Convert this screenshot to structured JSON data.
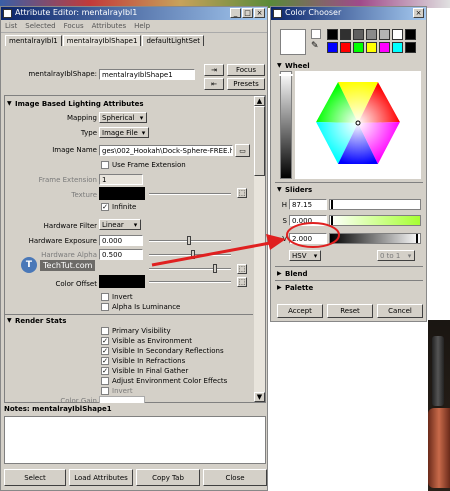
{
  "attr_editor": {
    "title": "Attribute Editor: mentalrayIbl1",
    "menu": [
      "List",
      "Selected",
      "Focus",
      "Attributes",
      "Help"
    ],
    "tabs": [
      "mentalrayIbl1",
      "mentalrayIblShape1",
      "defaultLightSet"
    ],
    "shape_label": "mentalrayIblShape:",
    "shape_value": "mentalrayIblShape1",
    "focus_btn": "Focus",
    "presets_btn": "Presets",
    "ibl_section": "Image Based Lighting Attributes",
    "mapping_label": "Mapping",
    "mapping_value": "Spherical",
    "type_label": "Type",
    "type_value": "Image File",
    "image_name_label": "Image Name",
    "image_name_value": "ges\\002_Hookah\\Dock-Sphere-FREE.hdr",
    "use_frame_ext": "Use Frame Extension",
    "frame_ext_label": "Frame Extension",
    "frame_ext_value": "1",
    "texture_label": "Texture",
    "infinite": "Infinite",
    "hw_filter_label": "Hardware Filter",
    "hw_filter_value": "Linear",
    "hw_exposure_label": "Hardware Exposure",
    "hw_exposure_value": "0.000",
    "hw_alpha_label": "Hardware Alpha",
    "hw_alpha_value": "0.500",
    "watermark": "TechTut.com",
    "color_offset_label": "Color Offset",
    "invert": "Invert",
    "alpha_is_lum": "Alpha Is Luminance",
    "render_stats_section": "Render Stats",
    "render_stats": [
      {
        "label": "Primary Visibility",
        "checked": false
      },
      {
        "label": "Visible as Environment",
        "checked": true
      },
      {
        "label": "Visible In Secondary Reflections",
        "checked": true
      },
      {
        "label": "Visible In Refractions",
        "checked": true
      },
      {
        "label": "Visible In Final Gather",
        "checked": true
      },
      {
        "label": "Adjust Environment Color Effects",
        "checked": false
      }
    ],
    "invert2": "Invert",
    "color_gain_label": "Color Gain",
    "notes_label": "Notes:  mentalrayIblShape1",
    "bottom_buttons": [
      "Select",
      "Load Attributes",
      "Copy Tab",
      "Close"
    ]
  },
  "color_chooser": {
    "title": "Color Chooser",
    "wheel_section": "Wheel",
    "sliders_section": "Sliders",
    "h_label": "H",
    "h_value": "87.15",
    "s_label": "S",
    "s_value": "0.000",
    "v_label": "V",
    "v_value": "2.000",
    "mode_value": "HSV",
    "range_value": "0 to 1",
    "blend_section": "Blend",
    "palette_section": "Palette",
    "buttons": [
      "Accept",
      "Reset",
      "Cancel"
    ],
    "palette_colors": [
      "#000000",
      "#303030",
      "#606060",
      "#8a8a8a",
      "#b4b4b4",
      "#ffffff",
      "#000000",
      "#0000ff",
      "#ff0000",
      "#00ff00",
      "#ffff00",
      "#ff00ff",
      "#00ffff",
      "#000000"
    ]
  },
  "annotation": {
    "arrow_color": "#e02020",
    "circle_color": "#e02020"
  }
}
